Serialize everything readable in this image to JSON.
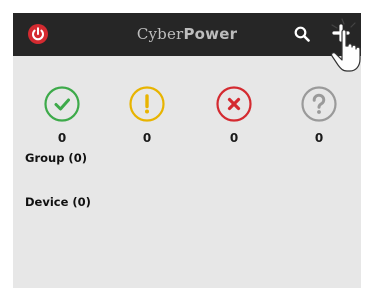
{
  "header": {
    "brand_part1": "Cyber",
    "brand_part2": "Power",
    "icons": {
      "power": "power-icon",
      "search": "search-icon",
      "add": "plus-icon"
    }
  },
  "status": {
    "normal": {
      "icon": "check-icon",
      "color": "#3daa4a",
      "count": "0"
    },
    "warning": {
      "icon": "exclamation-icon",
      "color": "#e8b400",
      "count": "0"
    },
    "critical": {
      "icon": "x-icon",
      "color": "#d42a30",
      "count": "0"
    },
    "unknown": {
      "icon": "question-icon",
      "color": "#9a9a9a",
      "count": "0"
    }
  },
  "sections": {
    "group": "Group (0)",
    "device": "Device (0)"
  },
  "colors": {
    "header_bg": "#262626",
    "content_bg": "#e7e7e7",
    "brand_red": "#d42a30"
  }
}
